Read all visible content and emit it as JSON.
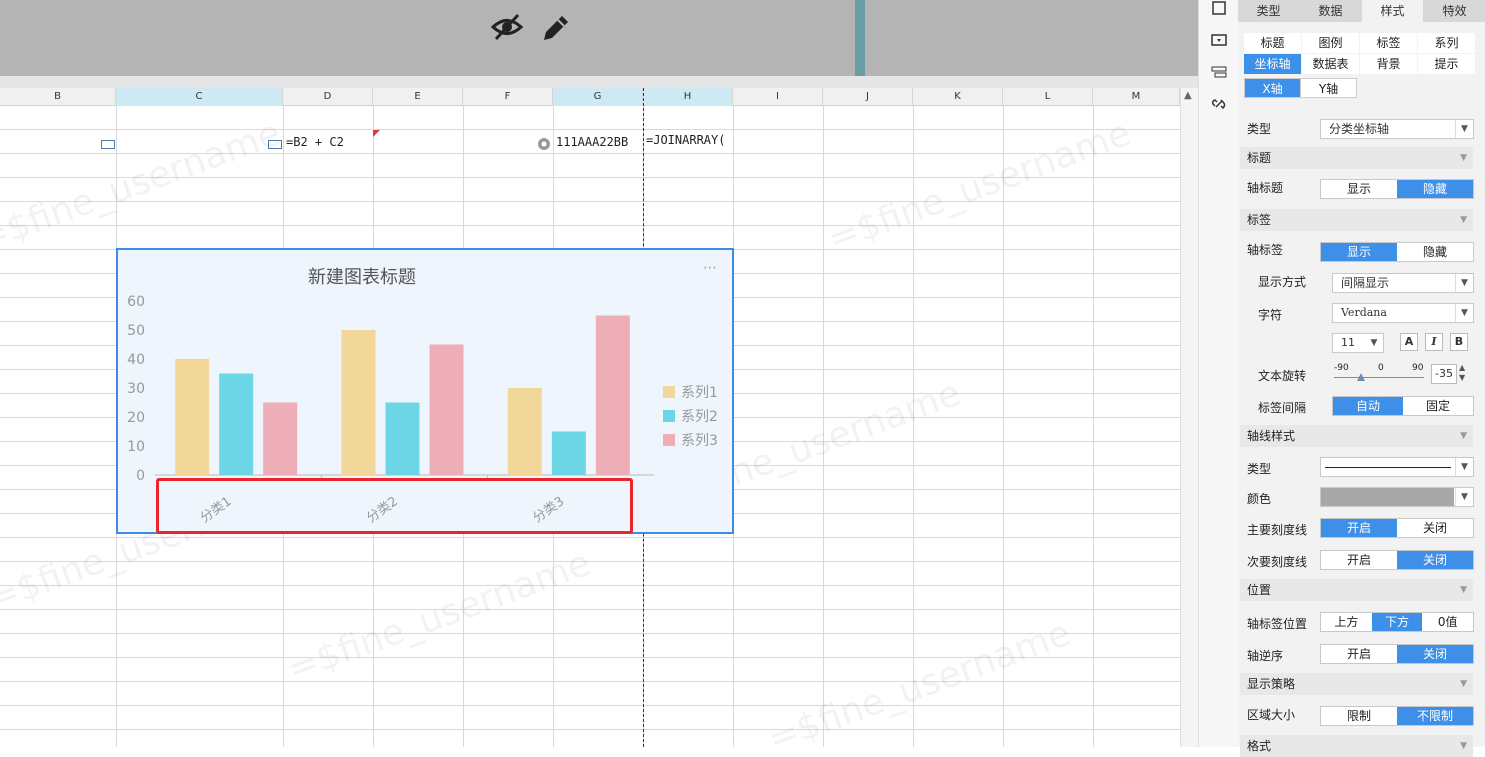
{
  "columns": [
    "B",
    "C",
    "D",
    "E",
    "F",
    "G",
    "H",
    "I",
    "J",
    "K",
    "L",
    "M"
  ],
  "cells": {
    "d_formula": "=B2 + C2",
    "g_value": "111AAA22BB",
    "h_formula": "=JOINARRAY("
  },
  "watermark": "=$fine_username",
  "chart_data": {
    "type": "bar",
    "title": "新建图表标题",
    "categories": [
      "分类1",
      "分类2",
      "分类3"
    ],
    "series": [
      {
        "name": "系列1",
        "values": [
          40,
          50,
          30
        ],
        "color": "#f2d79b"
      },
      {
        "name": "系列2",
        "values": [
          35,
          25,
          15
        ],
        "color": "#6dd6e6"
      },
      {
        "name": "系列3",
        "values": [
          25,
          45,
          55
        ],
        "color": "#eeaeb8"
      }
    ],
    "ylim": [
      0,
      60
    ],
    "yticks": [
      "0",
      "10",
      "20",
      "30",
      "40",
      "50",
      "60"
    ],
    "legend": "right",
    "x_label_rotation": -35,
    "more_icon": "⋯"
  },
  "panel": {
    "tabs": [
      "类型",
      "数据",
      "样式",
      "特效"
    ],
    "active_tab": "样式",
    "subtabs_row1": [
      "标题",
      "图例",
      "标签",
      "系列"
    ],
    "subtabs_row2": [
      "坐标轴",
      "数据表",
      "背景",
      "提示"
    ],
    "axis_tabs": [
      "X轴",
      "Y轴"
    ],
    "type_label": "类型",
    "type_value": "分类坐标轴",
    "sec_title": "标题",
    "axis_title_label": "轴标题",
    "axis_title_opts": [
      "显示",
      "隐藏"
    ],
    "sec_label": "标签",
    "axis_label_label": "轴标签",
    "axis_label_opts": [
      "显示",
      "隐藏"
    ],
    "display_mode_label": "显示方式",
    "display_mode_value": "间隔显示",
    "font_label": "字符",
    "font_value": "Verdana",
    "font_size": "11",
    "font_btns": [
      "A",
      "I",
      "B"
    ],
    "rotation_label": "文本旋转",
    "rotation_ticks": [
      "-90",
      "0",
      "90"
    ],
    "rotation_value": "-35",
    "interval_label": "标签间隔",
    "interval_opts": [
      "自动",
      "固定"
    ],
    "sec_axisline": "轴线样式",
    "line_type_label": "类型",
    "color_label": "颜色",
    "major_tick_label": "主要刻度线",
    "major_tick_opts": [
      "开启",
      "关闭"
    ],
    "minor_tick_label": "次要刻度线",
    "minor_tick_opts": [
      "开启",
      "关闭"
    ],
    "sec_position": "位置",
    "label_pos_label": "轴标签位置",
    "label_pos_opts": [
      "上方",
      "下方",
      "0值"
    ],
    "reverse_label": "轴逆序",
    "reverse_opts": [
      "开启",
      "关闭"
    ],
    "sec_strategy": "显示策略",
    "area_label": "区域大小",
    "area_opts": [
      "限制",
      "不限制"
    ],
    "sec_format": "格式"
  }
}
